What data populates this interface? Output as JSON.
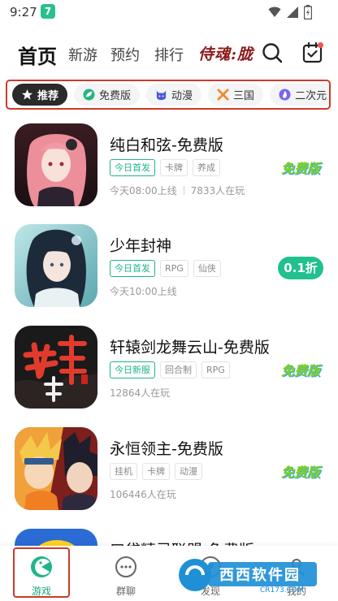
{
  "status_bar": {
    "time": "9:27",
    "app_badge": "7"
  },
  "top_nav": {
    "tabs": [
      {
        "label": "首页",
        "active": true
      },
      {
        "label": "新游"
      },
      {
        "label": "预约"
      },
      {
        "label": "排行"
      }
    ],
    "logo_text": "侍魂:胧"
  },
  "categories": [
    {
      "label": "推荐",
      "icon": "star-icon",
      "active": true
    },
    {
      "label": "免费版",
      "icon": "leaf-icon"
    },
    {
      "label": "动漫",
      "icon": "cat-face-icon"
    },
    {
      "label": "三国",
      "icon": "swords-icon"
    },
    {
      "label": "二次元",
      "icon": "flame-icon"
    }
  ],
  "games": [
    {
      "title": "纯白和弦-免费版",
      "tags": [
        "今日首发",
        "卡牌",
        "养成"
      ],
      "first_tag_highlight": true,
      "meta": [
        "今天08:00上线",
        "7833人在玩"
      ],
      "badge_type": "free",
      "badge_text": "免费版"
    },
    {
      "title": "少年封神",
      "tags": [
        "今日首发",
        "RPG",
        "仙侠"
      ],
      "first_tag_highlight": true,
      "meta": [
        "今天10:00上线"
      ],
      "badge_type": "discount",
      "badge_text": "0.1折"
    },
    {
      "title": "轩辕剑龙舞云山-免费版",
      "tags": [
        "今日新服",
        "回合制",
        "RPG"
      ],
      "first_tag_highlight": true,
      "meta": [
        "12864人在玩"
      ],
      "badge_type": "free",
      "badge_text": "免费版"
    },
    {
      "title": "永恒领主-免费版",
      "tags": [
        "挂机",
        "卡牌",
        "动漫"
      ],
      "first_tag_highlight": false,
      "meta": [
        "106446人在玩"
      ],
      "badge_type": "free",
      "badge_text": "免费版"
    },
    {
      "title": "口袋精灵联盟-免费版",
      "tags": [],
      "first_tag_highlight": false,
      "meta": [],
      "badge_type": "none",
      "badge_text": ""
    }
  ],
  "bottom_nav": [
    {
      "label": "游戏",
      "icon": "pacman-icon",
      "active": true
    },
    {
      "label": "群聊",
      "icon": "chat-bubble-icon"
    },
    {
      "label": "发现",
      "icon": "discover-icon"
    },
    {
      "label": "我的",
      "icon": "user-icon"
    }
  ],
  "watermark": {
    "brand": "西西软件园",
    "domain": "CR173.COM"
  },
  "colors": {
    "accent": "#21c08f",
    "highlight_border": "#c93b2c"
  }
}
